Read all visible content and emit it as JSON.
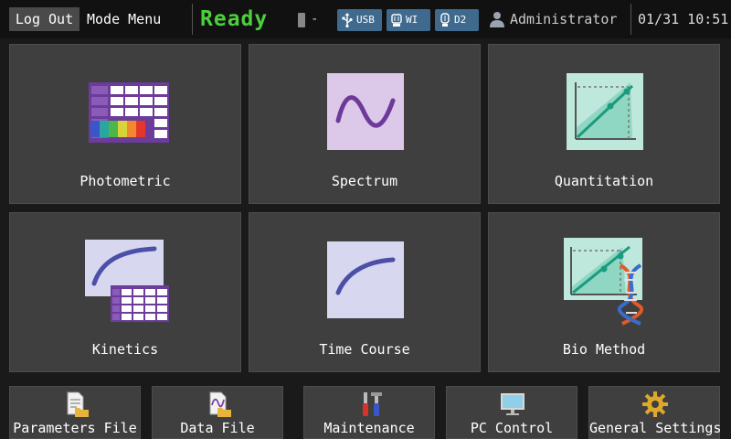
{
  "header": {
    "logout_label": "Log Out",
    "mode_label": "Mode Menu",
    "status": "Ready",
    "status_color": "#4ccf3c",
    "lamp_value": "-",
    "badges": [
      {
        "label": "USB",
        "icon": "usb-icon"
      },
      {
        "label": "WI",
        "icon": "wi-lamp-icon"
      },
      {
        "label": "D2",
        "icon": "d2-lamp-icon"
      }
    ],
    "badge_color": "#3f6a8e",
    "user": "Administrator",
    "datetime": "01/31 10:51"
  },
  "modes": [
    {
      "label": "Photometric",
      "icon": "photometric-icon"
    },
    {
      "label": "Spectrum",
      "icon": "spectrum-icon"
    },
    {
      "label": "Quantitation",
      "icon": "quantitation-icon"
    },
    {
      "label": "Kinetics",
      "icon": "kinetics-icon"
    },
    {
      "label": "Time Course",
      "icon": "time-course-icon"
    },
    {
      "label": "Bio Method",
      "icon": "bio-method-icon"
    }
  ],
  "footer": [
    {
      "label": "Parameters File",
      "icon": "parameters-file-icon"
    },
    {
      "label": "Data File",
      "icon": "data-file-icon"
    },
    {
      "label": "Maintenance",
      "icon": "maintenance-icon"
    },
    {
      "label": "PC Control",
      "icon": "pc-monitor-icon"
    },
    {
      "label": "General Settings",
      "icon": "gear-icon"
    }
  ]
}
